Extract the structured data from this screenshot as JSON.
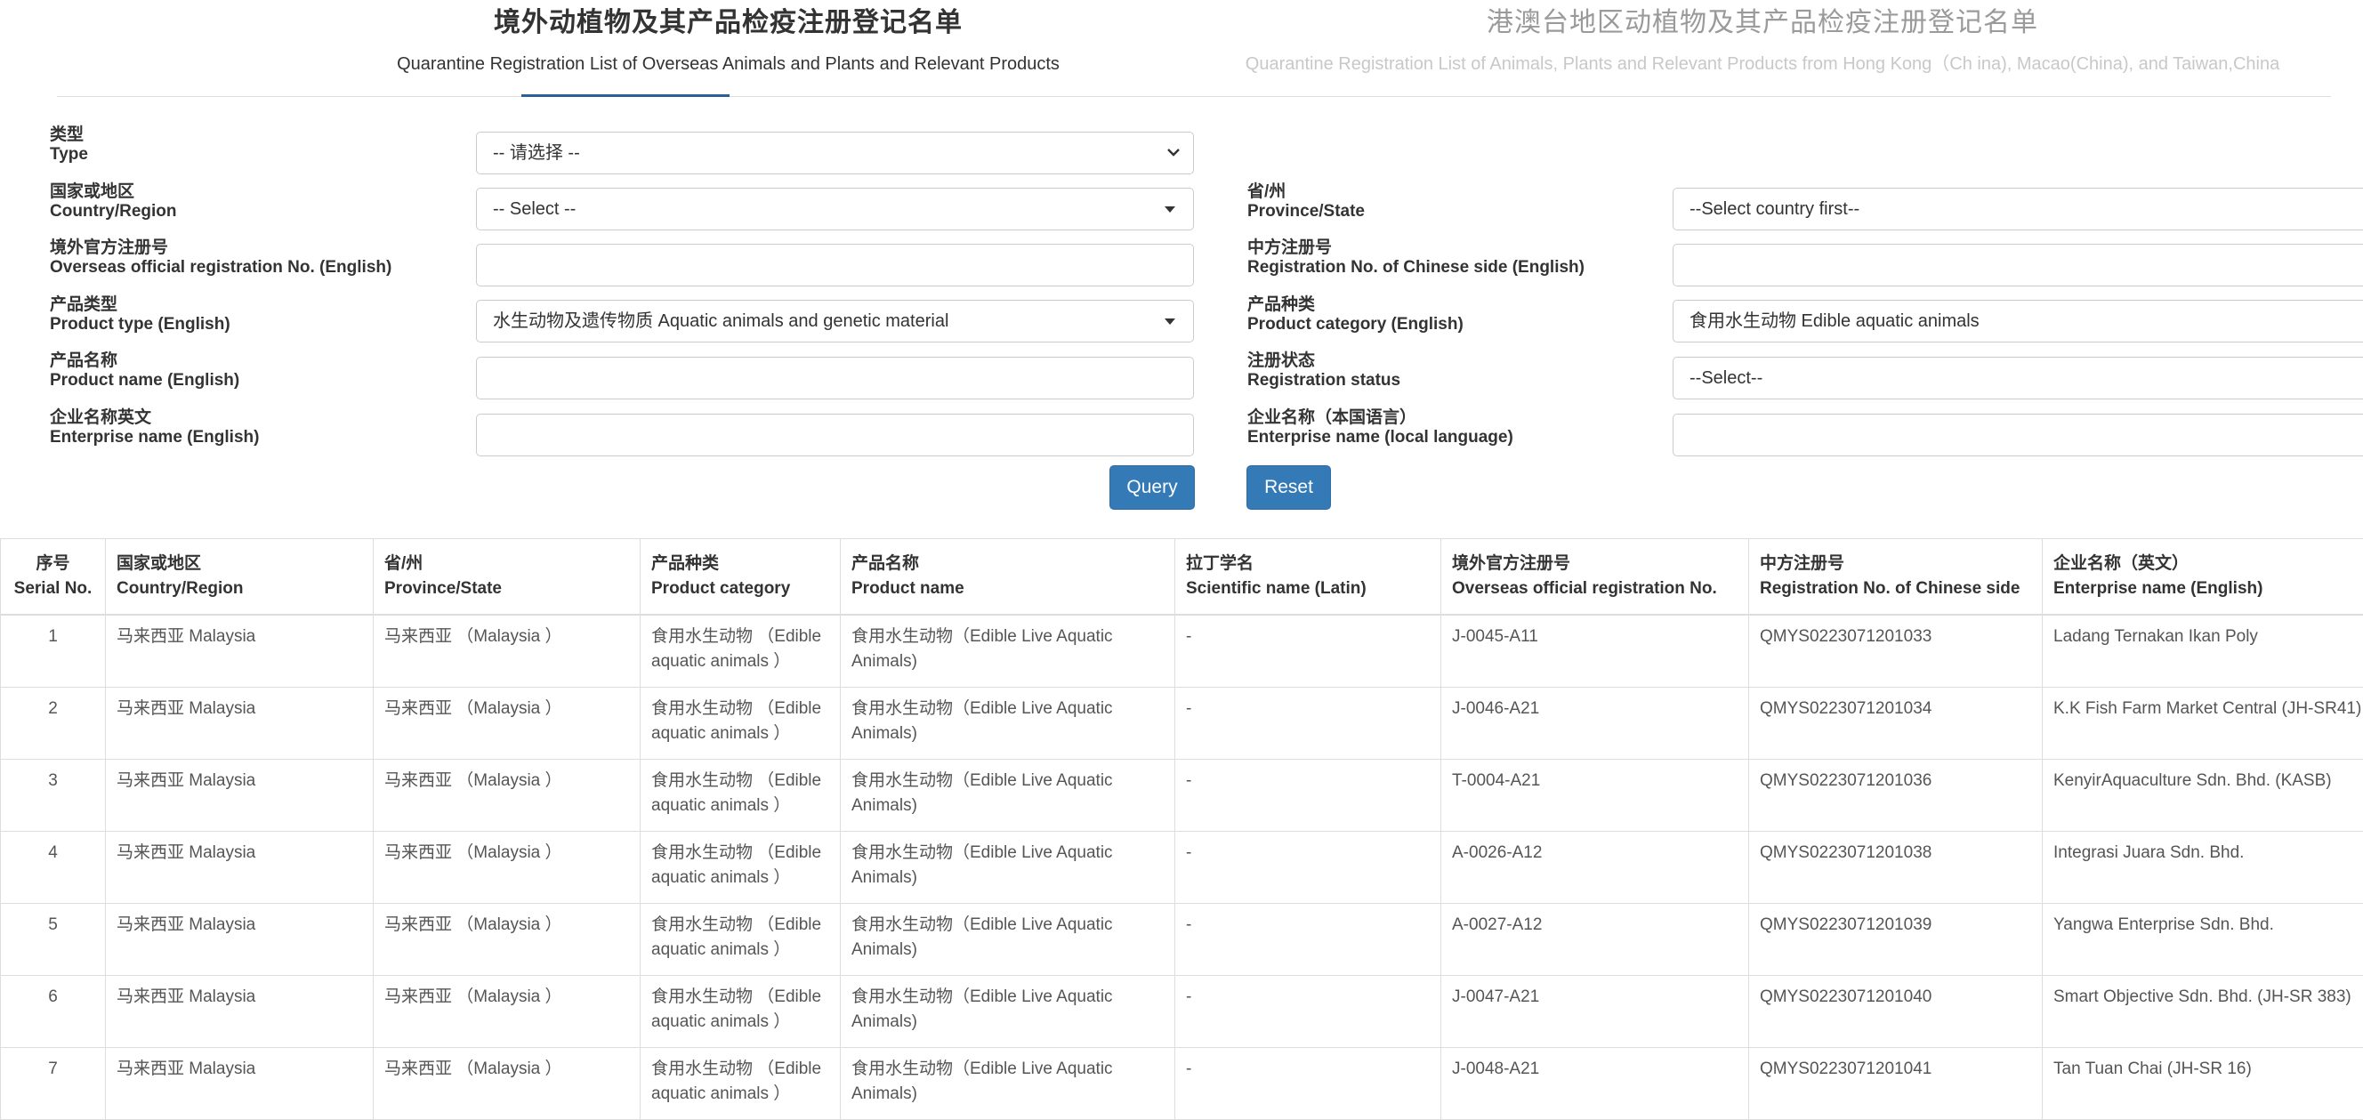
{
  "tabs": [
    {
      "title": "境外动植物及其产品检疫注册登记名单",
      "subtitle": "Quarantine Registration List of Overseas Animals and Plants and Relevant Products",
      "active": true
    },
    {
      "title": "港澳台地区动植物及其产品检疫注册登记名单",
      "subtitle": "Quarantine Registration List of Animals, Plants and Relevant Products from Hong Kong（Ch ina), Macao(China), and Taiwan,China",
      "active": false
    }
  ],
  "form": {
    "type": {
      "label_zh": "类型",
      "label_en": "Type",
      "value": "-- 请选择 --"
    },
    "country": {
      "label_zh": "国家或地区",
      "label_en": "Country/Region",
      "value": "-- Select --"
    },
    "province": {
      "label_zh": "省/州",
      "label_en": "Province/State",
      "value": "--Select country first--"
    },
    "overseas_reg": {
      "label_zh": "境外官方注册号",
      "label_en": "Overseas official registration No. (English)",
      "value": ""
    },
    "chinese_reg": {
      "label_zh": "中方注册号",
      "label_en": "Registration No. of Chinese side (English)",
      "value": ""
    },
    "product_type": {
      "label_zh": "产品类型",
      "label_en": "Product type (English)",
      "value": "水生动物及遗传物质 Aquatic animals and genetic material"
    },
    "product_category": {
      "label_zh": "产品种类",
      "label_en": "Product category (English)",
      "value": "食用水生动物 Edible aquatic animals"
    },
    "product_name": {
      "label_zh": "产品名称",
      "label_en": "Product name (English)",
      "value": ""
    },
    "reg_status": {
      "label_zh": "注册状态",
      "label_en": "Registration status",
      "value": "--Select--"
    },
    "enterprise_en": {
      "label_zh": "企业名称英文",
      "label_en": "Enterprise name (English)",
      "value": ""
    },
    "enterprise_local": {
      "label_zh": "企业名称（本国语言）",
      "label_en": "Enterprise name (local language)",
      "value": ""
    },
    "query_label": "Query",
    "reset_label": "Reset"
  },
  "table": {
    "columns": [
      {
        "zh": "序号",
        "en": "Serial No."
      },
      {
        "zh": "国家或地区",
        "en": "Country/Region"
      },
      {
        "zh": "省/州",
        "en": "Province/State"
      },
      {
        "zh": "产品种类",
        "en": "Product category"
      },
      {
        "zh": "产品名称",
        "en": "Product name"
      },
      {
        "zh": "拉丁学名",
        "en": "Scientific name (Latin)"
      },
      {
        "zh": "境外官方注册号",
        "en": "Overseas official registration No."
      },
      {
        "zh": "中方注册号",
        "en": "Registration No. of Chinese side"
      },
      {
        "zh": "企业名称（英文）",
        "en": "Enterprise name (English)"
      }
    ],
    "rows": [
      [
        "1",
        "马来西亚 Malaysia",
        "马来西亚 （Malaysia ）",
        "食用水生动物 （Edible aquatic animals ）",
        "食用水生动物（Edible Live Aquatic Animals)",
        "-",
        "J-0045-A11",
        "QMYS0223071201033",
        "Ladang Ternakan Ikan Poly"
      ],
      [
        "2",
        "马来西亚 Malaysia",
        "马来西亚 （Malaysia ）",
        "食用水生动物 （Edible aquatic animals ）",
        "食用水生动物（Edible Live Aquatic Animals)",
        "-",
        "J-0046-A21",
        "QMYS0223071201034",
        "K.K Fish Farm Market Central (JH-SR41)"
      ],
      [
        "3",
        "马来西亚 Malaysia",
        "马来西亚 （Malaysia ）",
        "食用水生动物 （Edible aquatic animals ）",
        "食用水生动物（Edible Live Aquatic Animals)",
        "-",
        "T-0004-A21",
        "QMYS0223071201036",
        "KenyirAquaculture Sdn. Bhd. (KASB)"
      ],
      [
        "4",
        "马来西亚 Malaysia",
        "马来西亚 （Malaysia ）",
        "食用水生动物 （Edible aquatic animals ）",
        "食用水生动物（Edible Live Aquatic Animals)",
        "-",
        "A-0026-A12",
        "QMYS0223071201038",
        "Integrasi Juara Sdn. Bhd."
      ],
      [
        "5",
        "马来西亚 Malaysia",
        "马来西亚 （Malaysia ）",
        "食用水生动物 （Edible aquatic animals ）",
        "食用水生动物（Edible Live Aquatic Animals)",
        "-",
        "A-0027-A12",
        "QMYS0223071201039",
        "Yangwa Enterprise Sdn. Bhd."
      ],
      [
        "6",
        "马来西亚 Malaysia",
        "马来西亚 （Malaysia ）",
        "食用水生动物 （Edible aquatic animals ）",
        "食用水生动物（Edible Live Aquatic Animals)",
        "-",
        "J-0047-A21",
        "QMYS0223071201040",
        "Smart Objective Sdn. Bhd. (JH-SR 383)"
      ],
      [
        "7",
        "马来西亚 Malaysia",
        "马来西亚 （Malaysia ）",
        "食用水生动物 （Edible aquatic animals ）",
        "食用水生动物（Edible Live Aquatic Animals)",
        "-",
        "J-0048-A21",
        "QMYS0223071201041",
        "Tan Tuan Chai (JH-SR 16)"
      ]
    ]
  },
  "colors": {
    "accent": "#2c5f96",
    "button": "#337ab7",
    "border": "#dddddd"
  }
}
